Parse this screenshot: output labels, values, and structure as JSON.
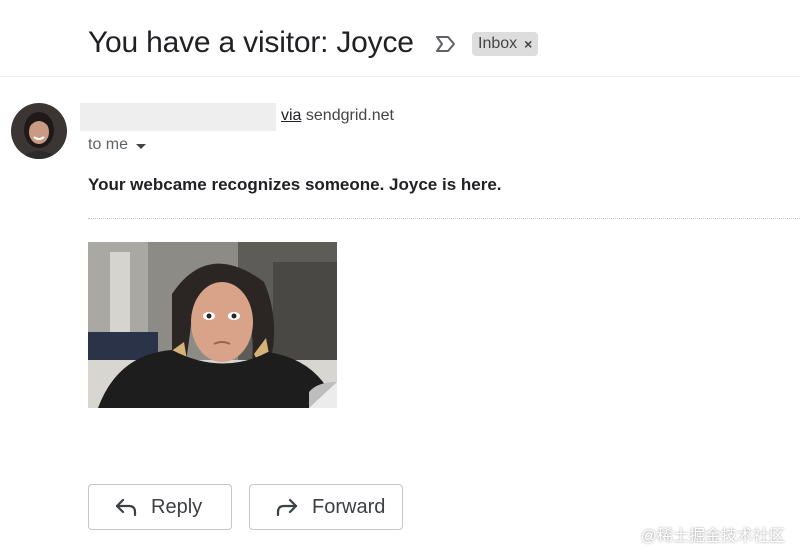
{
  "email": {
    "subject": "You have a visitor: Joyce",
    "label_chip": {
      "label": "Inbox",
      "remove_glyph": "×"
    },
    "sender": {
      "via_text": "via",
      "domain": "sendgrid.net"
    },
    "recipient": {
      "to_text": "to me"
    },
    "body": {
      "headline": "Your webcame recognizes someone. Joyce is here."
    }
  },
  "actions": {
    "reply_label": "Reply",
    "forward_label": "Forward"
  },
  "watermark": "@稀土掘金技术社区",
  "icons": {
    "important": "label-important-icon",
    "reply": "reply-arrow-icon",
    "forward": "forward-arrow-icon",
    "dropdown": "caret-down-icon"
  },
  "colors": {
    "chip_bg": "#dddddd",
    "button_border": "#c6c6c6",
    "text_primary": "#202124",
    "text_secondary": "#5f6368"
  }
}
